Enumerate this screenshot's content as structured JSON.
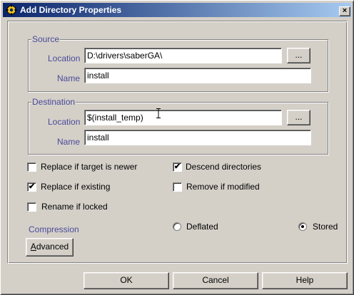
{
  "window": {
    "title": "Add Directory Properties",
    "close_symbol": "×"
  },
  "source": {
    "legend": "Source",
    "location_label": "Location",
    "location_value": "D:\\drivers\\saberGA\\",
    "browse_label": "...",
    "name_label": "Name",
    "name_value": "install"
  },
  "destination": {
    "legend": "Destination",
    "location_label": "Location",
    "location_value": "$(install_temp)",
    "browse_label": "...",
    "name_label": "Name",
    "name_value": "install"
  },
  "options": {
    "replace_if_newer": {
      "label": "Replace if target is newer",
      "checked": false
    },
    "descend_dirs": {
      "label": "Descend directories",
      "checked": true
    },
    "replace_if_existing": {
      "label": "Replace if existing",
      "checked": true
    },
    "remove_if_modified": {
      "label": "Remove if modified",
      "checked": false
    },
    "rename_if_locked": {
      "label": "Rename if locked",
      "checked": false
    }
  },
  "compression": {
    "label": "Compression",
    "deflated": {
      "label": "Deflated",
      "selected": false
    },
    "stored": {
      "label": "Stored",
      "selected": true
    }
  },
  "advanced_button": {
    "mnemonic": "A",
    "rest": "dvanced"
  },
  "footer": {
    "ok": "OK",
    "cancel": "Cancel",
    "help": "Help"
  }
}
